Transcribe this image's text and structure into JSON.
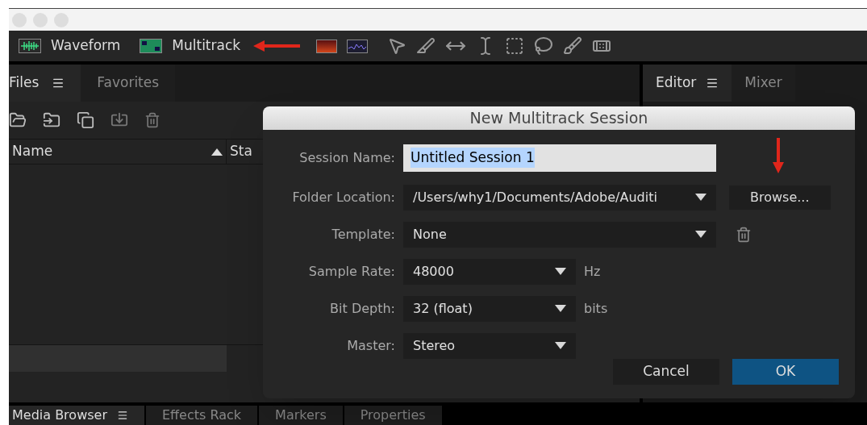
{
  "workspace_tabs": [
    {
      "label": "Waveform",
      "kind": "waveform"
    },
    {
      "label": "Multitrack",
      "kind": "multitrack"
    }
  ],
  "files_panel": {
    "tabs": [
      {
        "label": "Files",
        "selected": true
      },
      {
        "label": "Favorites",
        "selected": false
      }
    ],
    "columns": [
      {
        "label": "Name",
        "sorted": true
      },
      {
        "label": "Sta",
        "sorted": false
      }
    ]
  },
  "editor_panel": {
    "tabs": [
      {
        "label": "Editor",
        "selected": true
      },
      {
        "label": "Mixer",
        "selected": false
      }
    ]
  },
  "bottom_tabs": [
    {
      "label": "Media Browser",
      "selected": true
    },
    {
      "label": "Effects Rack",
      "selected": false
    },
    {
      "label": "Markers",
      "selected": false
    },
    {
      "label": "Properties",
      "selected": false
    }
  ],
  "dialog": {
    "title": "New Multitrack Session",
    "fields": [
      {
        "kind": "text",
        "label": "Session Name:",
        "value": "Untitled Session 1",
        "selected": true
      },
      {
        "kind": "dropdown",
        "label": "Folder Location:",
        "value": "/Users/why1/Documents/Adobe/Auditi",
        "action": "Browse..."
      },
      {
        "kind": "dropdown",
        "label": "Template:",
        "value": "None",
        "trash": true
      },
      {
        "kind": "short_dropdown",
        "label": "Sample Rate:",
        "value": "48000",
        "unit": "Hz"
      },
      {
        "kind": "short_dropdown",
        "label": "Bit Depth:",
        "value": "32 (float)",
        "unit": "bits"
      },
      {
        "kind": "short_dropdown",
        "label": "Master:",
        "value": "Stereo"
      }
    ],
    "buttons": [
      {
        "label": "Cancel",
        "primary": false
      },
      {
        "label": "OK",
        "primary": true
      }
    ]
  }
}
